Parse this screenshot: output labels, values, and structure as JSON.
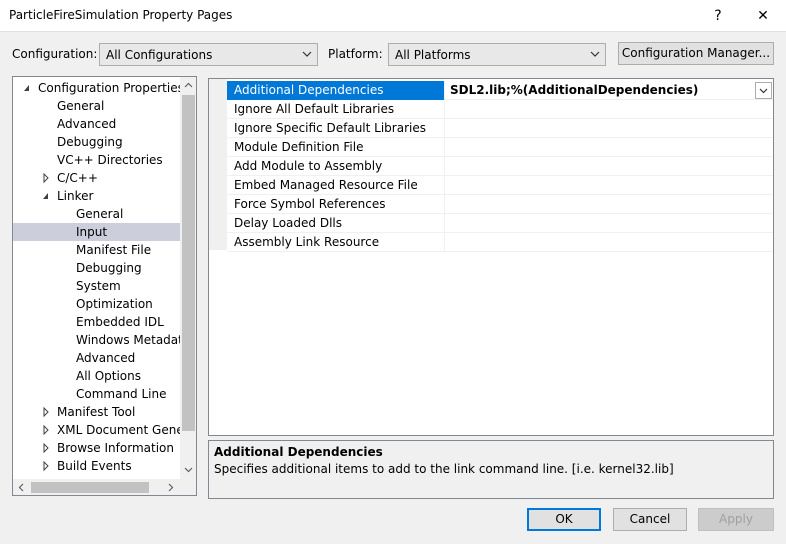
{
  "window": {
    "title": "ParticleFireSimulation Property Pages",
    "help": "?",
    "close": "✕"
  },
  "config": {
    "configuration_label": "Configuration:",
    "configuration_value": "All Configurations",
    "platform_label": "Platform:",
    "platform_value": "All Platforms",
    "manager_button": "Configuration Manager..."
  },
  "tree": {
    "items": [
      {
        "label": "Configuration Properties",
        "state": "expanded"
      },
      {
        "label": "General"
      },
      {
        "label": "Advanced"
      },
      {
        "label": "Debugging"
      },
      {
        "label": "VC++ Directories"
      },
      {
        "label": "C/C++",
        "state": "collapsed"
      },
      {
        "label": "Linker",
        "state": "expanded"
      },
      {
        "label": "General"
      },
      {
        "label": "Input",
        "selected": true
      },
      {
        "label": "Manifest File"
      },
      {
        "label": "Debugging"
      },
      {
        "label": "System"
      },
      {
        "label": "Optimization"
      },
      {
        "label": "Embedded IDL"
      },
      {
        "label": "Windows Metadata"
      },
      {
        "label": "Advanced"
      },
      {
        "label": "All Options"
      },
      {
        "label": "Command Line"
      },
      {
        "label": "Manifest Tool",
        "state": "collapsed"
      },
      {
        "label": "XML Document Genera",
        "state": "collapsed"
      },
      {
        "label": "Browse Information",
        "state": "collapsed"
      },
      {
        "label": "Build Events",
        "state": "collapsed"
      }
    ]
  },
  "properties": {
    "rows": [
      {
        "name": "Additional Dependencies",
        "value": "SDL2.lib;%(AdditionalDependencies)"
      },
      {
        "name": "Ignore All Default Libraries",
        "value": ""
      },
      {
        "name": "Ignore Specific Default Libraries",
        "value": ""
      },
      {
        "name": "Module Definition File",
        "value": ""
      },
      {
        "name": "Add Module to Assembly",
        "value": ""
      },
      {
        "name": "Embed Managed Resource File",
        "value": ""
      },
      {
        "name": "Force Symbol References",
        "value": ""
      },
      {
        "name": "Delay Loaded Dlls",
        "value": ""
      },
      {
        "name": "Assembly Link Resource",
        "value": ""
      }
    ]
  },
  "description": {
    "title": "Additional Dependencies",
    "text": "Specifies additional items to add to the link command line. [i.e. kernel32.lib]"
  },
  "buttons": {
    "ok": "OK",
    "cancel": "Cancel",
    "apply": "Apply"
  },
  "colors": {
    "accent": "#0078d7",
    "tree_selection": "#cccedb"
  }
}
